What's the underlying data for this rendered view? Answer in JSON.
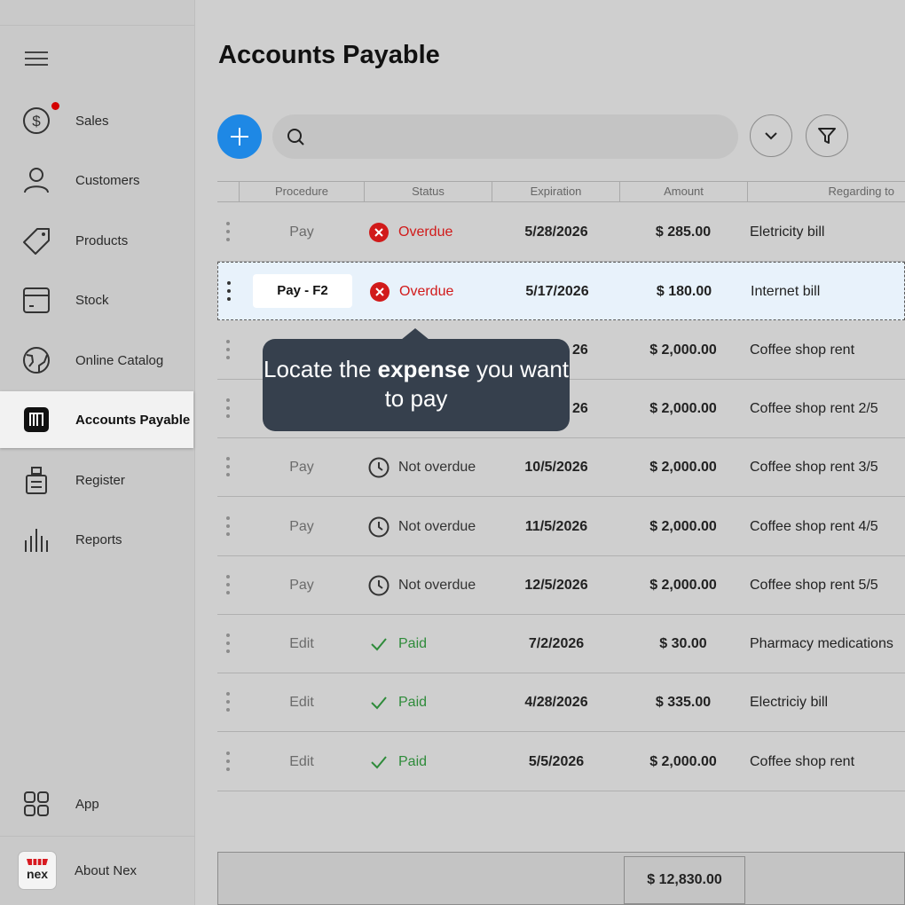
{
  "sidebar": {
    "items": [
      {
        "label": "Sales",
        "icon": "dollar-circle-icon",
        "has_notification": true
      },
      {
        "label": "Customers",
        "icon": "person-icon"
      },
      {
        "label": "Products",
        "icon": "tag-icon"
      },
      {
        "label": "Stock",
        "icon": "box-icon"
      },
      {
        "label": "Online Catalog",
        "icon": "globe-icon"
      },
      {
        "label": "Accounts Payable",
        "icon": "barcode-icon",
        "active": true
      },
      {
        "label": "Register",
        "icon": "register-icon"
      },
      {
        "label": "Reports",
        "icon": "bar-chart-icon"
      }
    ],
    "app_label": "App",
    "about_label": "About Nex",
    "logo_text": "nex",
    "notification_color": "#d40000"
  },
  "header": {
    "title": "Accounts Payable",
    "search_placeholder": ""
  },
  "table": {
    "columns": [
      "Procedure",
      "Status",
      "Expiration",
      "Amount",
      "Regarding to"
    ],
    "rows": [
      {
        "procedure": "Pay",
        "status": "Overdue",
        "status_kind": "overdue",
        "expiration": "5/28/2026",
        "amount": "$ 285.00",
        "regarding": "Eletricity bill"
      },
      {
        "procedure": "Pay - F2",
        "status": "Overdue",
        "status_kind": "overdue",
        "expiration": "5/17/2026",
        "amount": "$ 180.00",
        "regarding": "Internet bill",
        "selected": true
      },
      {
        "procedure": "",
        "status": "",
        "status_kind": "hidden",
        "expiration": "26",
        "amount": "$ 2,000.00",
        "regarding": "Coffee shop rent"
      },
      {
        "procedure": "",
        "status": "",
        "status_kind": "hidden",
        "expiration": "26",
        "amount": "$ 2,000.00",
        "regarding": "Coffee shop rent 2/5"
      },
      {
        "procedure": "Pay",
        "status": "Not overdue",
        "status_kind": "not-overdue",
        "expiration": "10/5/2026",
        "amount": "$ 2,000.00",
        "regarding": "Coffee shop rent 3/5"
      },
      {
        "procedure": "Pay",
        "status": "Not overdue",
        "status_kind": "not-overdue",
        "expiration": "11/5/2026",
        "amount": "$ 2,000.00",
        "regarding": "Coffee shop rent 4/5"
      },
      {
        "procedure": "Pay",
        "status": "Not overdue",
        "status_kind": "not-overdue",
        "expiration": "12/5/2026",
        "amount": "$ 2,000.00",
        "regarding": "Coffee shop rent 5/5"
      },
      {
        "procedure": "Edit",
        "status": "Paid",
        "status_kind": "paid",
        "expiration": "7/2/2026",
        "amount": "$ 30.00",
        "regarding": "Pharmacy medications"
      },
      {
        "procedure": "Edit",
        "status": "Paid",
        "status_kind": "paid",
        "expiration": "4/28/2026",
        "amount": "$ 335.00",
        "regarding": "Electriciy bill"
      },
      {
        "procedure": "Edit",
        "status": "Paid",
        "status_kind": "paid",
        "expiration": "5/5/2026",
        "amount": "$ 2,000.00",
        "regarding": "Coffee shop rent"
      }
    ],
    "total": "$ 12,830.00"
  },
  "tooltip": {
    "prefix": "Locate the ",
    "bold": "expense",
    "suffix": " you want to pay"
  },
  "colors": {
    "accent": "#1e88e5",
    "overdue": "#d11a1a",
    "paid": "#2e8b3a",
    "tooltip_bg": "#36404d",
    "selected_row": "#e8f2fb"
  }
}
